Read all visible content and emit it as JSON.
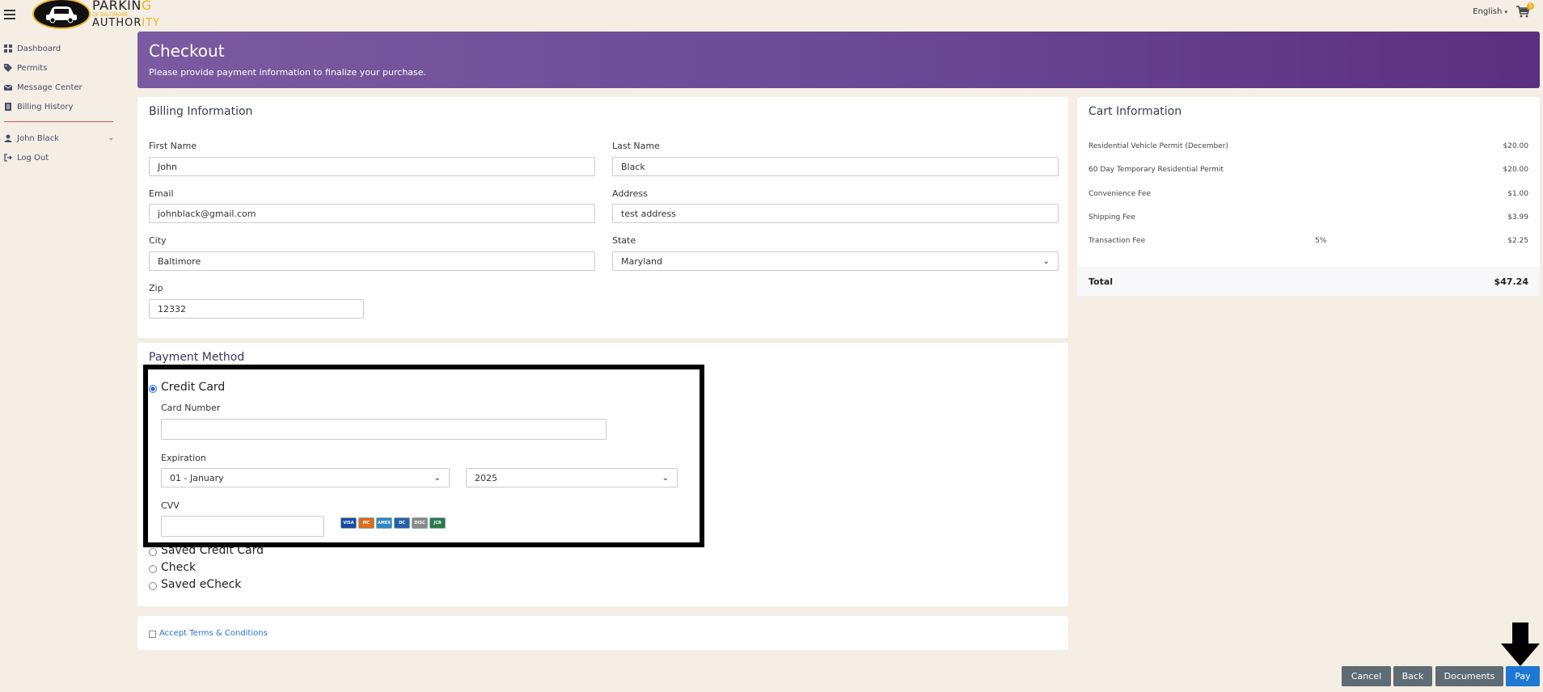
{
  "topbar": {
    "logo_line1": "PARKIN",
    "logo_line1_hl": "G",
    "logo_line2": "OF BALTIMORE",
    "logo_line3": "AUTHOR",
    "logo_line3_hl": "ITY",
    "language": "English",
    "cart_count": "5"
  },
  "sidebar": {
    "items": [
      {
        "label": "Dashboard",
        "icon": "dashboard-icon"
      },
      {
        "label": "Permits",
        "icon": "tags-icon"
      },
      {
        "label": "Message Center",
        "icon": "envelope-icon"
      },
      {
        "label": "Billing History",
        "icon": "document-icon"
      }
    ],
    "user": "John Black",
    "logout": "Log Out"
  },
  "header": {
    "title": "Checkout",
    "subtitle": "Please provide payment information to finalize your purchase."
  },
  "billing": {
    "title": "Billing Information",
    "first_name_label": "First Name",
    "first_name": "John",
    "last_name_label": "Last Name",
    "last_name": "Black",
    "email_label": "Email",
    "email": "johnblack@gmail.com",
    "address_label": "Address",
    "address": "test address",
    "city_label": "City",
    "city": "Baltimore",
    "state_label": "State",
    "state": "Maryland",
    "zip_label": "Zip",
    "zip": "12332"
  },
  "payment": {
    "title": "Payment Method",
    "credit_card": "Credit Card",
    "card_number_label": "Card Number",
    "card_number": "",
    "expiration_label": "Expiration",
    "exp_month": "01 - January",
    "exp_year": "2025",
    "cvv_label": "CVV",
    "cvv": "",
    "card_brands": [
      "VISA",
      "MC",
      "AMEX",
      "DC",
      "DISC",
      "JCB"
    ],
    "saved_credit_card": "Saved Credit Card",
    "check": "Check",
    "saved_echeck": "Saved eCheck"
  },
  "terms": {
    "label": "Accept Terms & Conditions"
  },
  "cart": {
    "title": "Cart Information",
    "items": [
      {
        "name": "Residential Vehicle Permit (December)",
        "pct": "",
        "amount": "$20.00"
      },
      {
        "name": "60 Day Temporary Residential Permit",
        "pct": "",
        "amount": "$20.00"
      },
      {
        "name": "Convenience Fee",
        "pct": "",
        "amount": "$1.00"
      },
      {
        "name": "Shipping Fee",
        "pct": "",
        "amount": "$3.99"
      },
      {
        "name": "Transaction Fee",
        "pct": "5%",
        "amount": "$2.25"
      }
    ],
    "total_label": "Total",
    "total": "$47.24"
  },
  "buttons": {
    "cancel": "Cancel",
    "back": "Back",
    "documents": "Documents",
    "pay": "Pay"
  },
  "colors": {
    "header_start": "#7a5aa0",
    "header_end": "#5c2f7e",
    "primary": "#1e77d3",
    "secondary": "#5f6b75",
    "accent": "#f2b21c"
  }
}
